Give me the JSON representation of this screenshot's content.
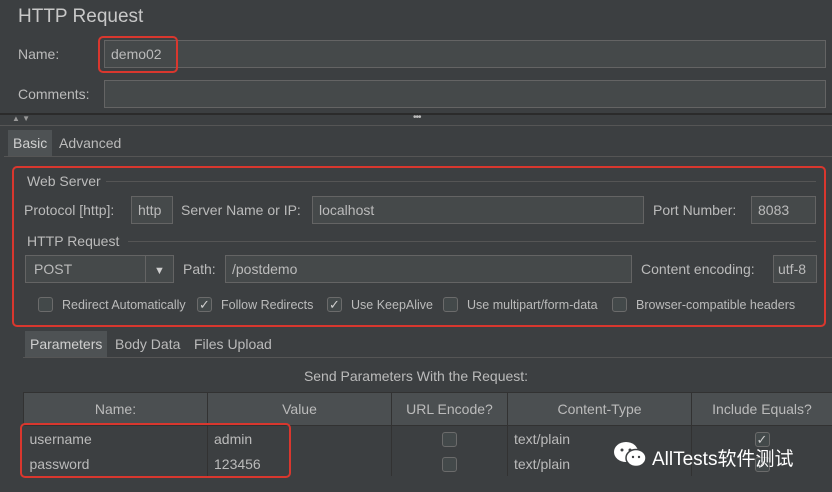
{
  "title": "HTTP Request",
  "name_field": {
    "label": "Name:",
    "value": "demo02"
  },
  "comments_field": {
    "label": "Comments:",
    "value": ""
  },
  "split_handle": "•••",
  "collapse_arrows": "▲ ▼",
  "top_tabs": [
    {
      "label": "Basic"
    },
    {
      "label": "Advanced"
    }
  ],
  "web_server": {
    "title": "Web Server",
    "protocol_label": "Protocol [http]:",
    "protocol_value": "http",
    "server_label": "Server Name or IP:",
    "server_value": "localhost",
    "port_label": "Port Number:",
    "port_value": "8083"
  },
  "http_request": {
    "title": "HTTP Request",
    "method": "POST",
    "path_label": "Path:",
    "path_value": "/postdemo",
    "encoding_label": "Content encoding:",
    "encoding_value": "utf-8"
  },
  "options": [
    {
      "label": "Redirect Automatically",
      "checked": false
    },
    {
      "label": "Follow Redirects",
      "checked": true
    },
    {
      "label": "Use KeepAlive",
      "checked": true
    },
    {
      "label": "Use multipart/form-data",
      "checked": false
    },
    {
      "label": "Browser-compatible headers",
      "checked": false
    }
  ],
  "param_tabs": [
    {
      "label": "Parameters"
    },
    {
      "label": "Body Data"
    },
    {
      "label": "Files Upload"
    }
  ],
  "params_caption": "Send Parameters With the Request:",
  "params_columns": [
    "Name:",
    "Value",
    "URL Encode?",
    "Content-Type",
    "Include Equals?"
  ],
  "params_rows": [
    {
      "name": "username",
      "value": "admin",
      "url_encode": false,
      "content_type": "text/plain",
      "include_equals": true
    },
    {
      "name": "password",
      "value": "123456",
      "url_encode": false,
      "content_type": "text/plain",
      "include_equals": true
    }
  ],
  "watermark": "AllTests软件测试",
  "colors": {
    "background": "#3c3f41",
    "highlight": "#d9372e",
    "field": "#45494a"
  },
  "icons": {
    "dropdown": "chevron-down-icon",
    "check": "check-icon",
    "wechat": "wechat-icon"
  }
}
